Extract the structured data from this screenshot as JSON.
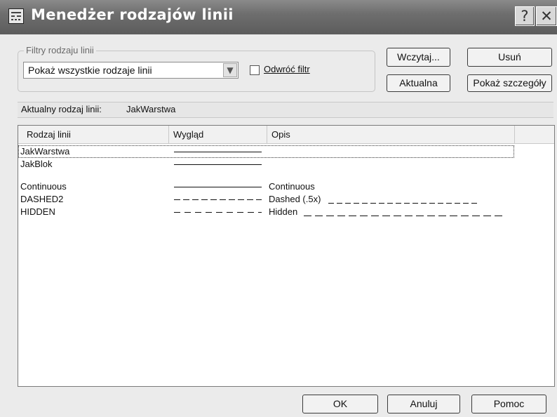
{
  "window": {
    "title": "Menedżer rodzajów linii",
    "help_glyph": "?",
    "close_glyph": "✕"
  },
  "filter": {
    "legend": "Filtry rodzaju linii",
    "selected": "Pokaż wszystkie rodzaje linii",
    "invert_label": "Odwróć filtr",
    "invert_checked": false
  },
  "buttons": {
    "load": "Wczytaj...",
    "delete": "Usuń",
    "current": "Aktualna",
    "details": "Pokaż szczegóły",
    "ok": "OK",
    "cancel": "Anuluj",
    "help": "Pomoc"
  },
  "current_linetype": {
    "label": "Aktualny rodzaj linii:",
    "value": "JakWarstwa"
  },
  "table": {
    "columns": [
      "Rodzaj linii",
      "Wygląd",
      "Opis"
    ],
    "rows": [
      {
        "name": "JakWarstwa",
        "appearance": "solid",
        "description": ""
      },
      {
        "name": "JakBlok",
        "appearance": "solid",
        "description": ""
      },
      {
        "name": "Continuous",
        "appearance": "solid",
        "description": "Continuous"
      },
      {
        "name": "DASHED2",
        "appearance": "dashed",
        "description": "Dashed (.5x)"
      },
      {
        "name": "HIDDEN",
        "appearance": "hidden",
        "description": "Hidden"
      }
    ]
  },
  "icons": {
    "app": "linetype-manager-icon",
    "dropdown": "chevron-down-icon",
    "help": "help-icon",
    "close": "close-icon"
  },
  "colors": {
    "titlebar": "#6e6e6e",
    "dialog_background": "#ebebeb",
    "list_background": "#ffffff"
  }
}
